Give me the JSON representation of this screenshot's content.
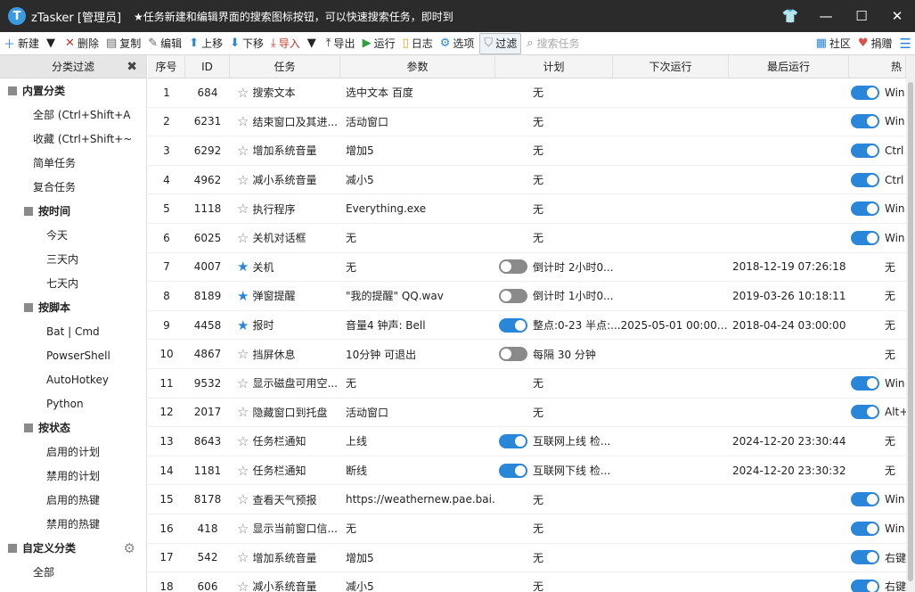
{
  "window": {
    "app_name": "zTasker [管理员]",
    "tip": "★任务新建和编辑界面的搜索图标按钮，可以快速搜索任务，即时到",
    "controls": [
      "👕",
      "—",
      "☐",
      "✕"
    ]
  },
  "toolbar": {
    "items": [
      {
        "icon": "＋",
        "label": "新建",
        "color": "#2a86d8"
      },
      {
        "icon": "▼",
        "label": "",
        "color": "#222"
      },
      {
        "icon": "✕",
        "label": "删除",
        "color": "#c0392b"
      },
      {
        "icon": "▤",
        "label": "复制",
        "color": "#666"
      },
      {
        "icon": "✎",
        "label": "编辑",
        "color": "#666"
      },
      {
        "icon": "⬆",
        "label": "上移",
        "color": "#2a86d8"
      },
      {
        "icon": "⬇",
        "label": "下移",
        "color": "#2a86d8"
      },
      {
        "icon": "⤓",
        "label": "导入",
        "color": "#c0392b"
      },
      {
        "icon": "▼",
        "label": "",
        "color": "#222"
      },
      {
        "icon": "⤒",
        "label": "导出",
        "color": "#333"
      },
      {
        "icon": "▶",
        "label": "运行",
        "color": "#2e9e3e"
      },
      {
        "icon": "▯",
        "label": "日志",
        "color": "#d4a017"
      },
      {
        "icon": "⚙",
        "label": "选项",
        "color": "#2a86d8"
      }
    ],
    "filter_label": "过滤",
    "search_placeholder": "搜索任务",
    "community_label": "社区",
    "donate_label": "捐赠"
  },
  "sidebar": {
    "header": "分类过滤",
    "builtin_group": "内置分类",
    "builtin_items": [
      "全部 (Ctrl+Shift+A",
      "收藏 (Ctrl+Shift+~",
      "简单任务",
      "复合任务"
    ],
    "time_group": "按时间",
    "time_items": [
      "今天",
      "三天内",
      "七天内"
    ],
    "script_group": "按脚本",
    "script_items": [
      "Bat | Cmd",
      "PowserShell",
      "AutoHotkey",
      "Python"
    ],
    "state_group": "按状态",
    "state_items": [
      "启用的计划",
      "禁用的计划",
      "启用的热键",
      "禁用的热键"
    ],
    "custom_group": "自定义分类",
    "custom_items": [
      "全部"
    ]
  },
  "table": {
    "columns": [
      "序号",
      "ID",
      "任务",
      "参数",
      "计划",
      "下次运行",
      "最后运行",
      "热"
    ],
    "rows": [
      {
        "no": "1",
        "id": "684",
        "star": false,
        "task": "搜索文本",
        "param": "选中文本 百度",
        "plan_toggle": "",
        "plan": "无",
        "next": "",
        "last": "",
        "hot_toggle": "on",
        "hot": "Win"
      },
      {
        "no": "2",
        "id": "6231",
        "star": false,
        "task": "结束窗口及其进...",
        "param": "活动窗口",
        "plan_toggle": "",
        "plan": "无",
        "next": "",
        "last": "",
        "hot_toggle": "on",
        "hot": "Win"
      },
      {
        "no": "3",
        "id": "6292",
        "star": false,
        "task": "增加系统音量",
        "param": "增加5",
        "plan_toggle": "",
        "plan": "无",
        "next": "",
        "last": "",
        "hot_toggle": "on",
        "hot": "Ctrl"
      },
      {
        "no": "4",
        "id": "4962",
        "star": false,
        "task": "减小系统音量",
        "param": "减小5",
        "plan_toggle": "",
        "plan": "无",
        "next": "",
        "last": "",
        "hot_toggle": "on",
        "hot": "Ctrl"
      },
      {
        "no": "5",
        "id": "1118",
        "star": false,
        "task": "执行程序",
        "param": "Everything.exe",
        "plan_toggle": "",
        "plan": "无",
        "next": "",
        "last": "",
        "hot_toggle": "on",
        "hot": "Win"
      },
      {
        "no": "6",
        "id": "6025",
        "star": false,
        "task": "关机对话框",
        "param": "无",
        "plan_toggle": "",
        "plan": "无",
        "next": "",
        "last": "",
        "hot_toggle": "on",
        "hot": "Win"
      },
      {
        "no": "7",
        "id": "4007",
        "star": true,
        "task": "关机",
        "param": "无",
        "plan_toggle": "off",
        "plan": "倒计时 2小时0...",
        "next": "",
        "last": "2018-12-19 07:26:18",
        "hot_toggle": "",
        "hot": "无"
      },
      {
        "no": "8",
        "id": "8189",
        "star": true,
        "task": "弹窗提醒",
        "param": "\"我的提醒\" QQ.wav",
        "plan_toggle": "off",
        "plan": "倒计时 1小时0...",
        "next": "",
        "last": "2019-03-26 10:18:11",
        "hot_toggle": "",
        "hot": "无"
      },
      {
        "no": "9",
        "id": "4458",
        "star": true,
        "task": "报时",
        "param": "音量4 钟声: Bell",
        "plan_toggle": "on",
        "plan": "整点:0-23 半点:...2025-05-01 00:00:00",
        "next": "",
        "last": "2018-04-24 03:00:00",
        "hot_toggle": "",
        "hot": "无"
      },
      {
        "no": "10",
        "id": "4867",
        "star": false,
        "task": "挡屏休息",
        "param": "10分钟 可退出",
        "plan_toggle": "off",
        "plan": "每隔 30 分钟",
        "next": "",
        "last": "",
        "hot_toggle": "",
        "hot": "无"
      },
      {
        "no": "11",
        "id": "9532",
        "star": false,
        "task": "显示磁盘可用空...",
        "param": "无",
        "plan_toggle": "",
        "plan": "无",
        "next": "",
        "last": "",
        "hot_toggle": "on",
        "hot": "Win"
      },
      {
        "no": "12",
        "id": "2017",
        "star": false,
        "task": "隐藏窗口到托盘",
        "param": "活动窗口",
        "plan_toggle": "",
        "plan": "无",
        "next": "",
        "last": "",
        "hot_toggle": "on",
        "hot": "Alt+"
      },
      {
        "no": "13",
        "id": "8643",
        "star": false,
        "task": "任务栏通知",
        "param": "上线",
        "plan_toggle": "on",
        "plan": "互联网上线 检...",
        "next": "",
        "last": "2024-12-20 23:30:44",
        "hot_toggle": "",
        "hot": "无"
      },
      {
        "no": "14",
        "id": "1181",
        "star": false,
        "task": "任务栏通知",
        "param": "断线",
        "plan_toggle": "on",
        "plan": "互联网下线 检...",
        "next": "",
        "last": "2024-12-20 23:30:32",
        "hot_toggle": "",
        "hot": "无"
      },
      {
        "no": "15",
        "id": "8178",
        "star": false,
        "task": "查看天气预报",
        "param": "https://weathernew.pae.bai...",
        "plan_toggle": "",
        "plan": "无",
        "next": "",
        "last": "",
        "hot_toggle": "on",
        "hot": "Win"
      },
      {
        "no": "16",
        "id": "418",
        "star": false,
        "task": "显示当前窗口信...",
        "param": "无",
        "plan_toggle": "",
        "plan": "无",
        "next": "",
        "last": "",
        "hot_toggle": "on",
        "hot": "Win"
      },
      {
        "no": "17",
        "id": "542",
        "star": false,
        "task": "增加系统音量",
        "param": "增加5",
        "plan_toggle": "",
        "plan": "无",
        "next": "",
        "last": "",
        "hot_toggle": "on",
        "hot": "右键"
      },
      {
        "no": "18",
        "id": "606",
        "star": false,
        "task": "减小系统音量",
        "param": "减小5",
        "plan_toggle": "",
        "plan": "无",
        "next": "",
        "last": "",
        "hot_toggle": "on",
        "hot": "右键"
      }
    ]
  }
}
